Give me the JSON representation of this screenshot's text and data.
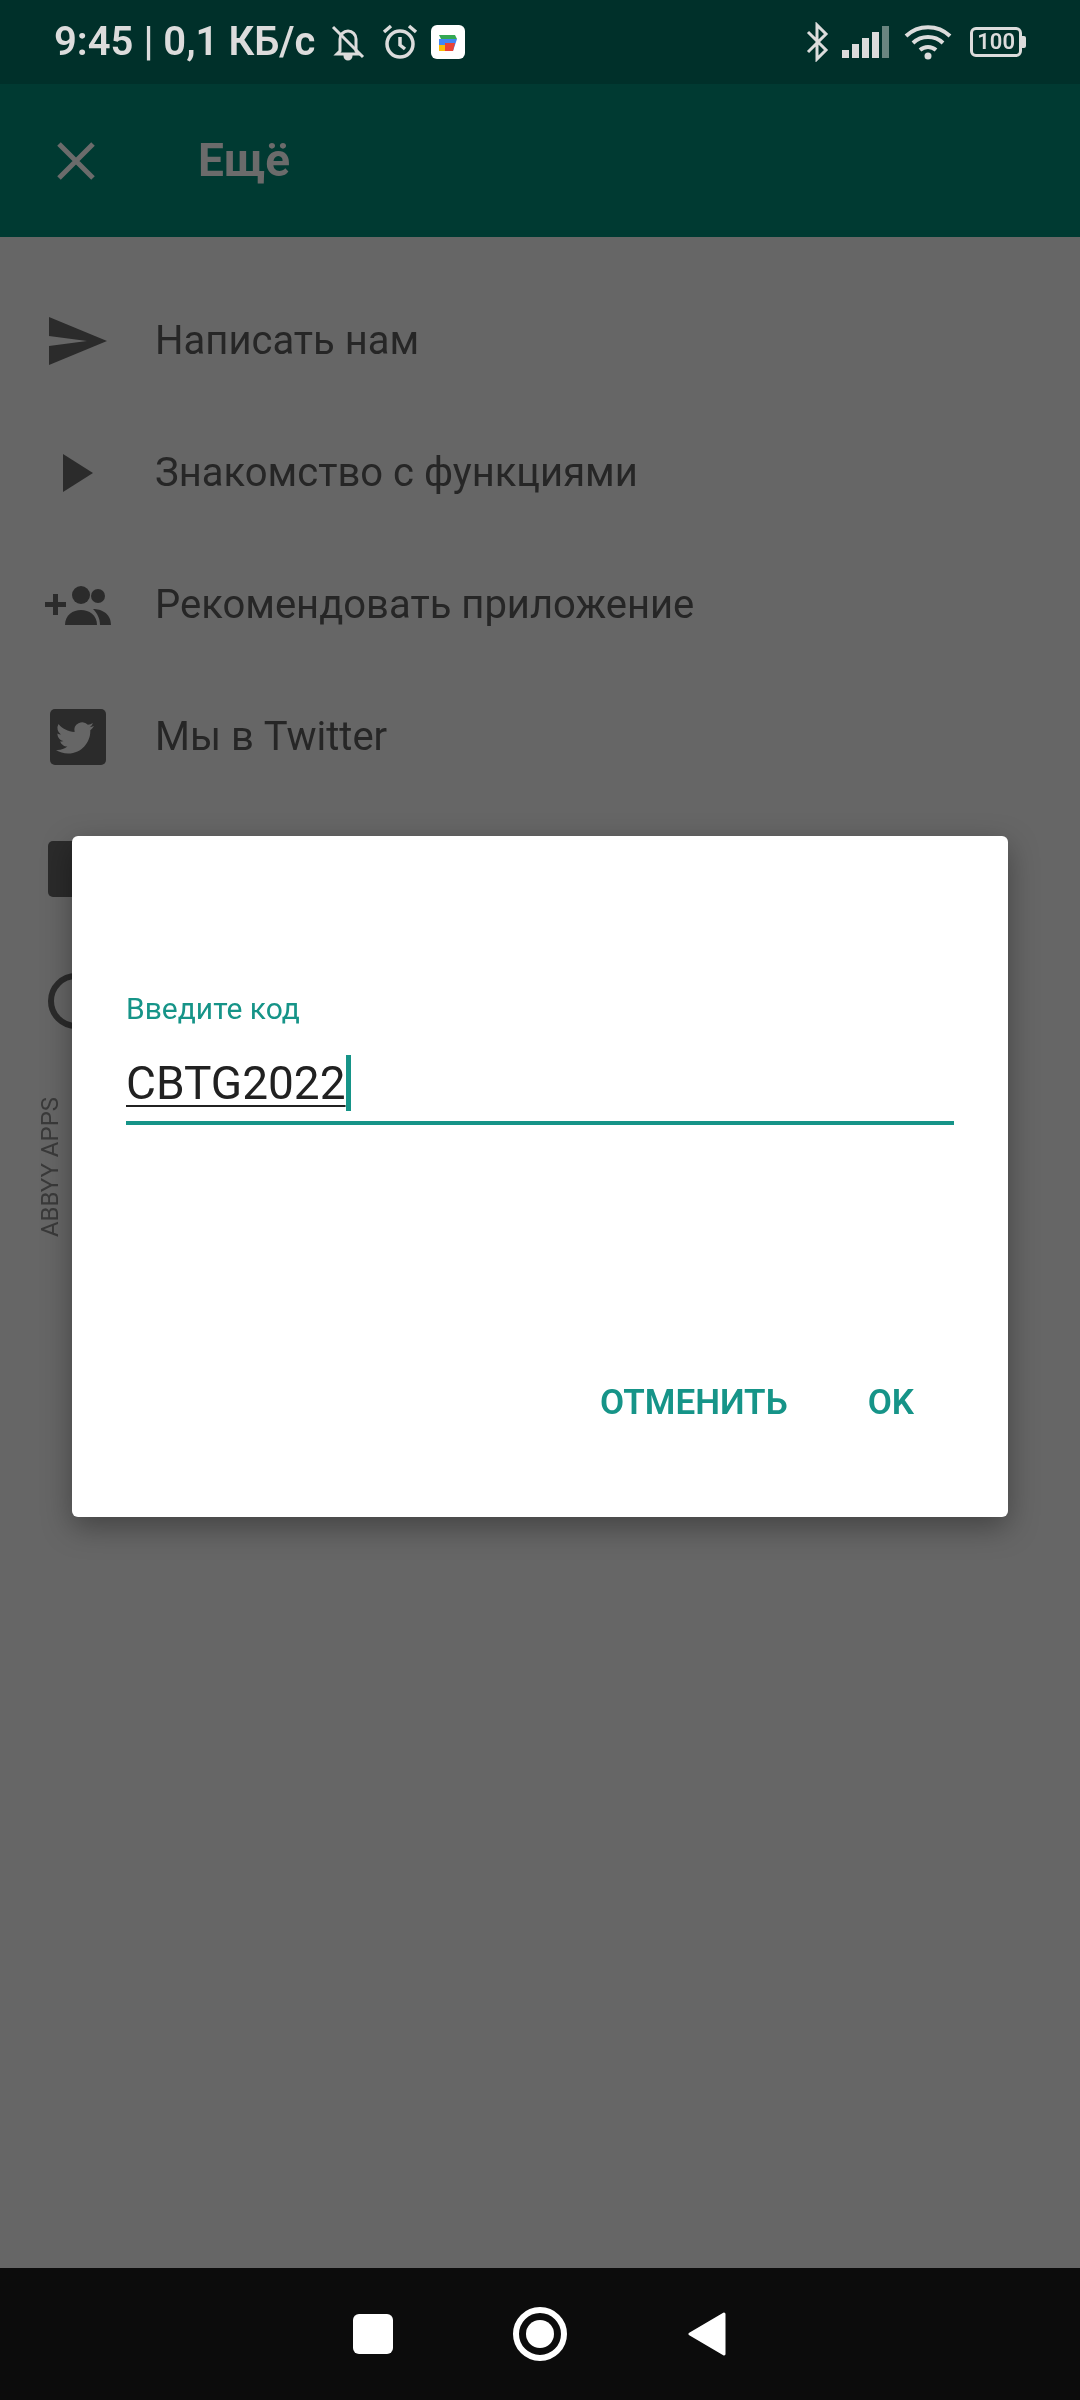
{
  "status_bar": {
    "time_speed": "9:45 | 0,1 КБ/с",
    "battery": "100"
  },
  "app_bar": {
    "title": "Ещё"
  },
  "menu": [
    {
      "kind": "send",
      "label": "Написать нам"
    },
    {
      "kind": "play",
      "label": "Знакомство с функциями"
    },
    {
      "kind": "people",
      "label": "Рекомендовать приложение"
    },
    {
      "kind": "twitter",
      "label": "Мы в Twitter"
    }
  ],
  "side_label": "ABBYY APPS",
  "dialog": {
    "field_label": "Введите код",
    "value": "CBTG2022",
    "buttons": [
      "ОТМЕНИТЬ",
      "OK"
    ]
  }
}
